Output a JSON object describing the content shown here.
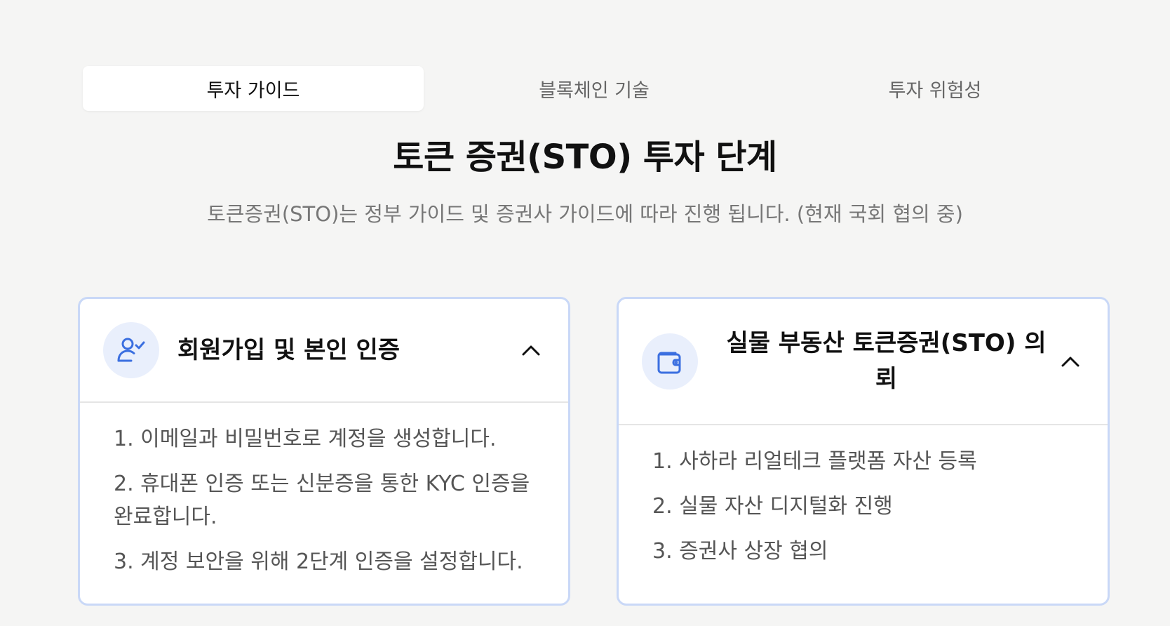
{
  "tabs": [
    {
      "label": "투자 가이드",
      "active": true
    },
    {
      "label": "블록체인 기술",
      "active": false
    },
    {
      "label": "투자 위험성",
      "active": false
    }
  ],
  "heading": {
    "title": "토큰 증권(STO) 투자 단계",
    "subtitle": "토큰증권(STO)는 정부 가이드 및 증권사 가이드에 따라 진행 됩니다. (현재 국회 협의 중)"
  },
  "cards": [
    {
      "icon": "user-check-icon",
      "title": "회원가입 및 본인 인증",
      "steps": [
        "1. 이메일과 비밀번호로 계정을 생성합니다.",
        "2. 휴대폰 인증 또는 신분증을 통한 KYC 인증을 완료합니다.",
        "3. 계정 보안을 위해 2단계 인증을 설정합니다."
      ]
    },
    {
      "icon": "wallet-icon",
      "title": "실물 부동산 토큰증권(STO) 의뢰",
      "steps": [
        "1. 사하라 리얼테크 플랫폼 자산 등록",
        "2. 실물 자산 디지털화 진행",
        "3. 증권사 상장 협의"
      ]
    }
  ],
  "colors": {
    "background": "#f5f5f4",
    "accent": "#3b6fe0",
    "card_border": "#c9d8f7",
    "icon_bg": "#e9effc"
  }
}
